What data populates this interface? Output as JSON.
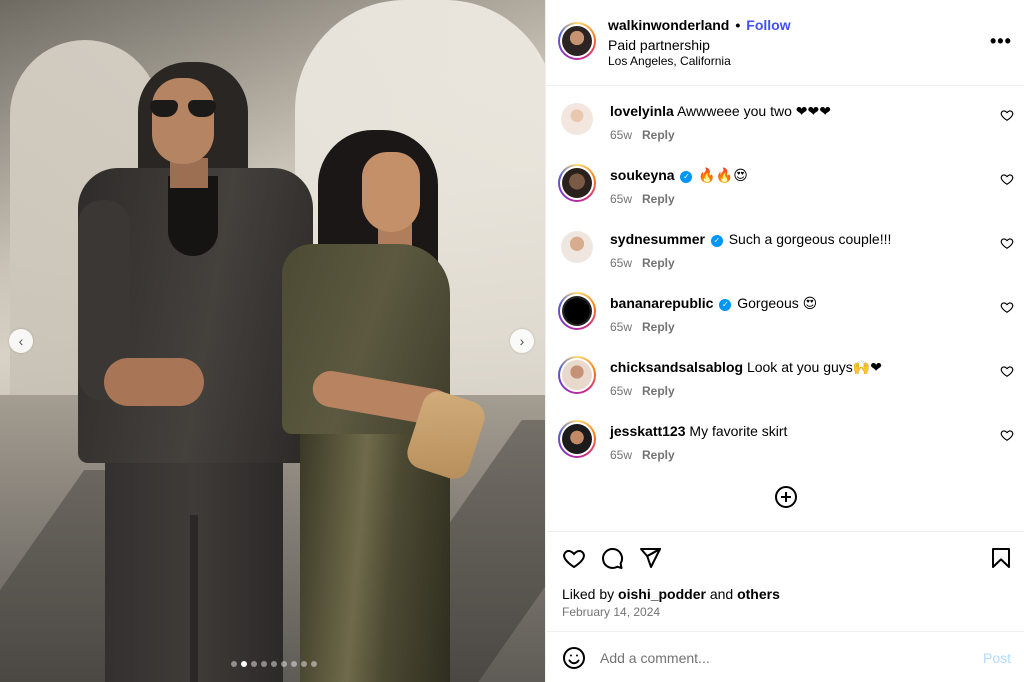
{
  "post": {
    "username": "walkinwonderland",
    "separator": "•",
    "follow_label": "Follow",
    "subtitle": "Paid partnership",
    "location": "Los Angeles, California",
    "more_icon": "more-options-icon"
  },
  "media": {
    "carousel_total": 9,
    "carousel_index": 2,
    "prev_icon": "chevron-left-icon",
    "next_icon": "chevron-right-icon",
    "prev_glyph": "‹",
    "next_glyph": "›"
  },
  "comments": [
    {
      "username": "lovelyinla",
      "verified": false,
      "text": "Awwweee you two ❤❤❤",
      "age": "65w",
      "reply_label": "Reply"
    },
    {
      "username": "soukeyna",
      "verified": true,
      "text": "🔥🔥😍",
      "age": "65w",
      "reply_label": "Reply"
    },
    {
      "username": "sydnesummer",
      "verified": true,
      "text": "Such a gorgeous couple!!!",
      "age": "65w",
      "reply_label": "Reply"
    },
    {
      "username": "bananarepublic",
      "verified": true,
      "text": "Gorgeous 😍",
      "age": "65w",
      "reply_label": "Reply"
    },
    {
      "username": "chicksandsalsablog",
      "verified": false,
      "text": "Look at you guys🙌❤",
      "age": "65w",
      "reply_label": "Reply"
    },
    {
      "username": "jesskatt123",
      "verified": false,
      "text": "My favorite skirt",
      "age": "65w",
      "reply_label": "Reply"
    }
  ],
  "actions": {
    "liked_prefix": "Liked by",
    "liked_user": "oishi_podder",
    "liked_and": "and",
    "liked_others": "others",
    "date": "February 14, 2024"
  },
  "compose": {
    "placeholder": "Add a comment...",
    "post_label": "Post"
  },
  "colors": {
    "accent": "#4150f7",
    "verified": "#0095f6",
    "secondary_text": "#737373",
    "post_disabled": "#b3dbff"
  }
}
